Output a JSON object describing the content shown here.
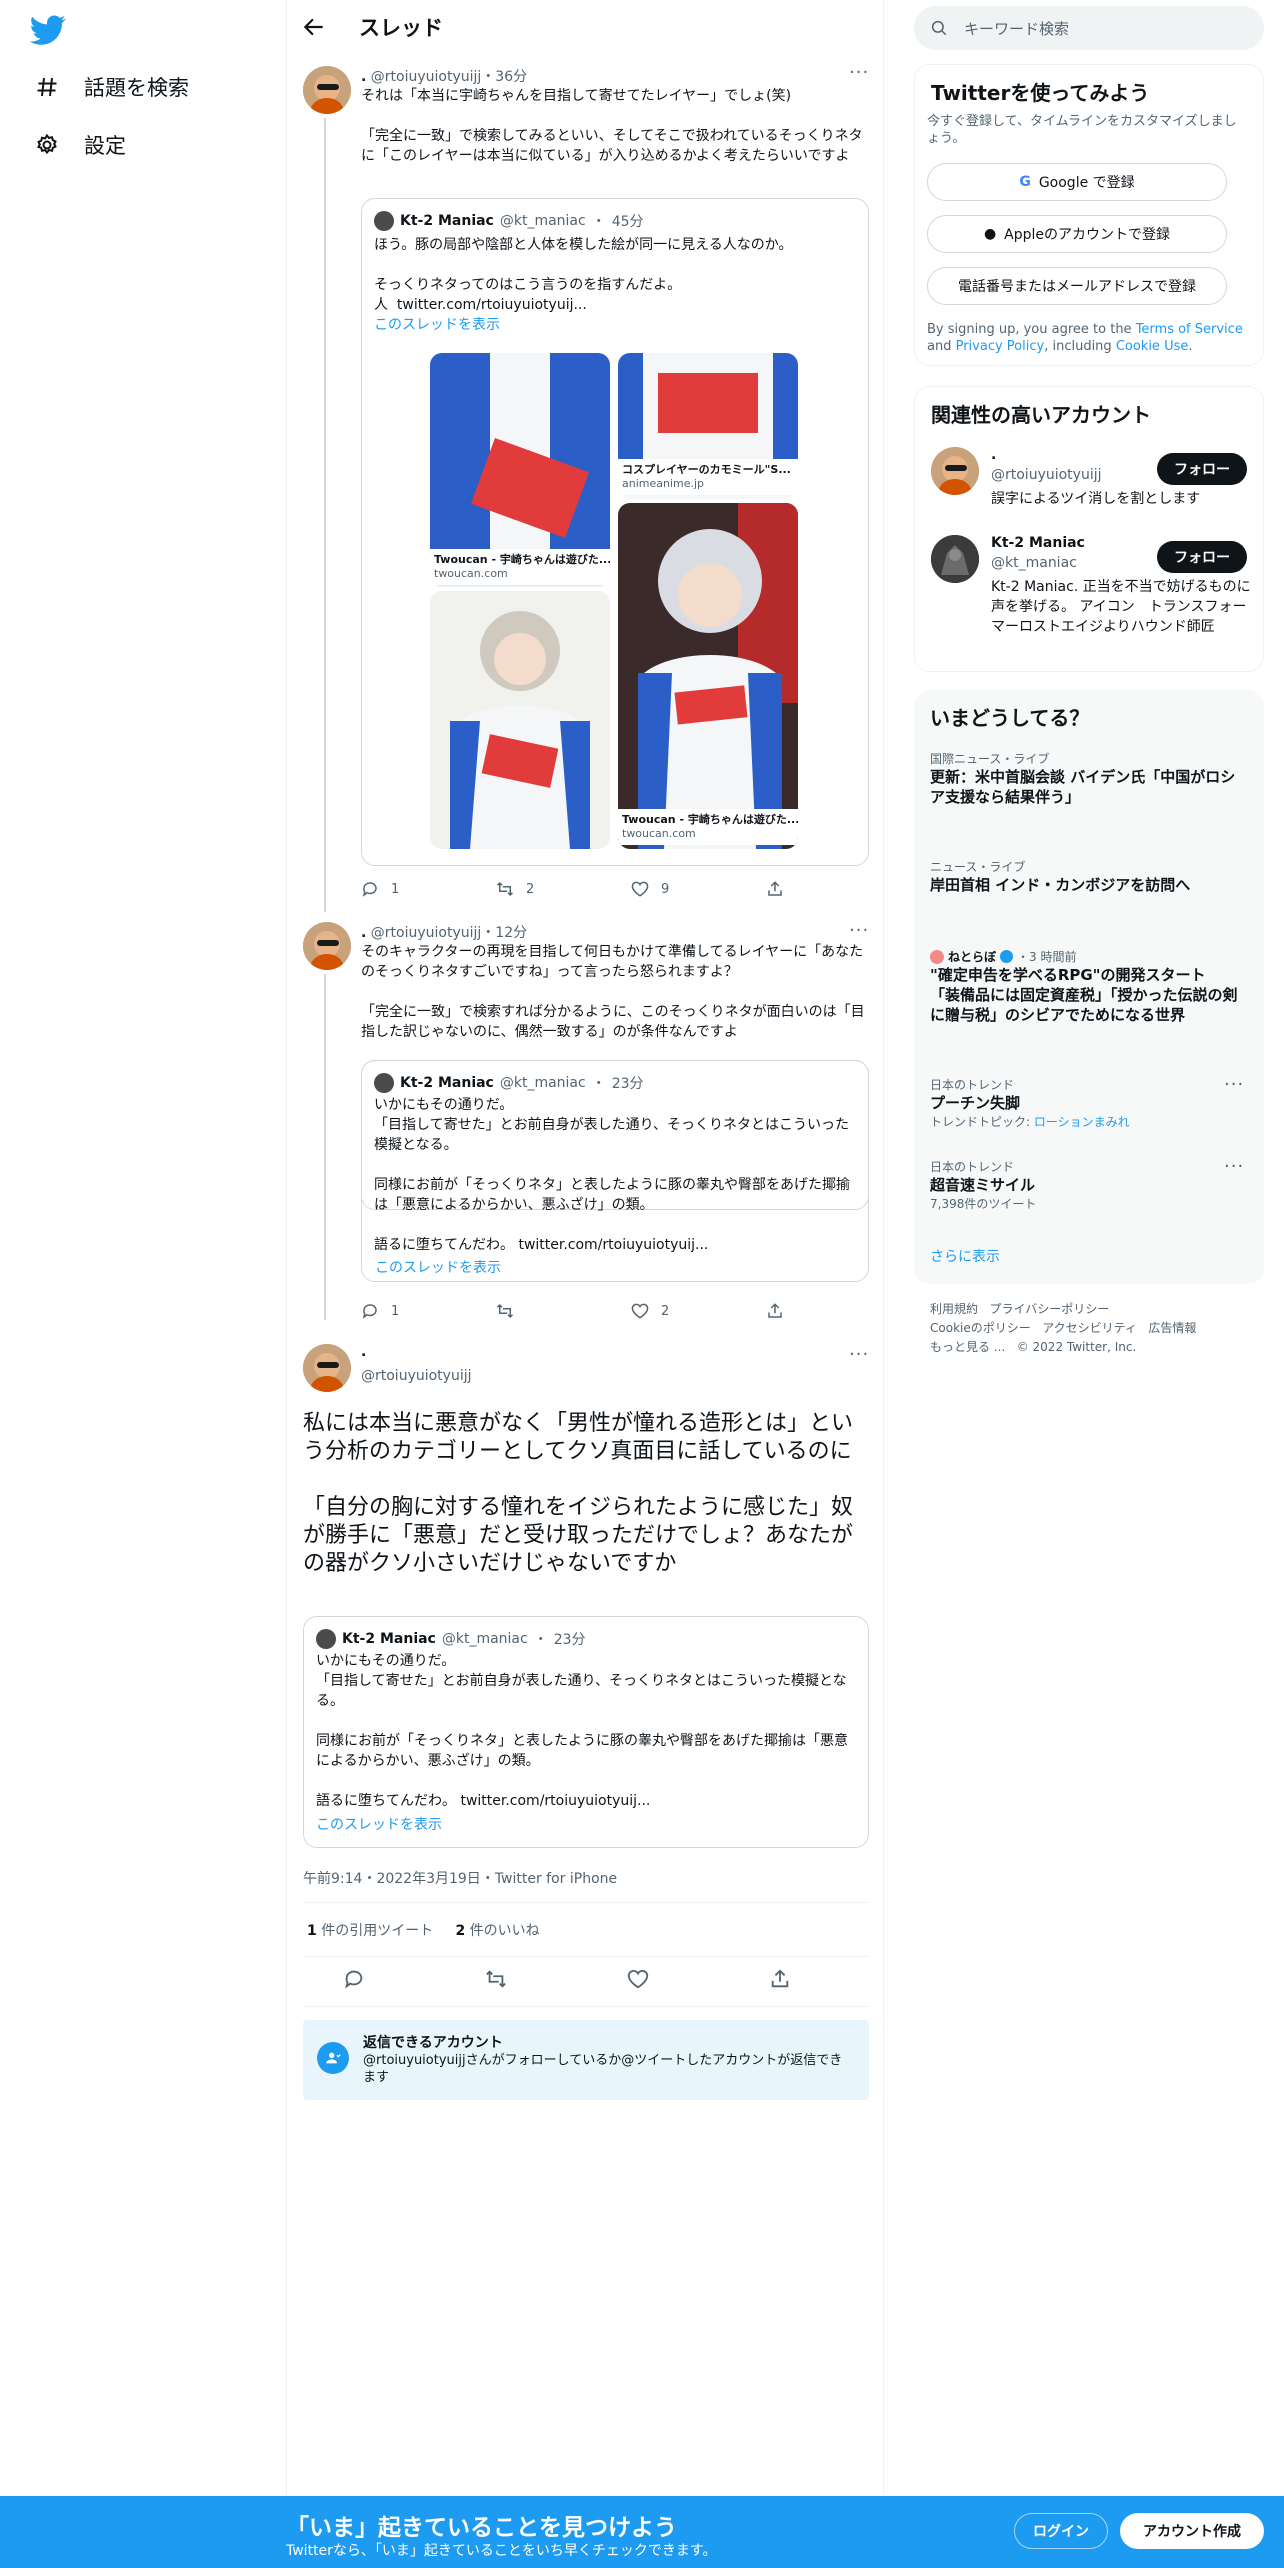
{
  "nav": {
    "explore_label": "話題を検索",
    "settings_label": "設定"
  },
  "header": {
    "title": "スレッド"
  },
  "tweet1": {
    "name": ".",
    "handle": "@rtoiuyuiotyuijj",
    "time": "36分",
    "text": "それは「本当に宇崎ちゃんを目指して寄せてたレイヤー」でしょ(笑)\n\n「完全に一致」で検索してみるといい、そしてそこで扱われているそっくりネタに「このレイヤーは本当に似ている」が入り込めるかよく考えたらいいですよ",
    "quote": {
      "name": "Kt-2 Maniac",
      "handle": "@kt_maniac",
      "time": "45分",
      "text": "ほう。豚の局部や陰部と人体を模した絵が同一に見える人なのか。\n\nそっくりネタってのはこう言うのを指すんだよ。\n人  twitter.com/rtoiuyuiotyuij...",
      "thread_link": "このスレッドを表示",
      "media": [
        {
          "title": "Twoucan - 宇崎ちゃんは遊びた...",
          "domain": "twoucan.com"
        },
        {
          "title": "コスプレイヤーのカモミール\"S...",
          "domain": "animeanime.jp"
        },
        {
          "title": "Twoucan - 宇崎ちゃんは遊びた...",
          "domain": "twoucan.com"
        }
      ]
    },
    "replies": "1",
    "retweets": "2",
    "likes": "9"
  },
  "tweet2": {
    "name": ".",
    "handle": "@rtoiuyuiotyuijj",
    "time": "12分",
    "text": "そのキャラクターの再現を目指して何日もかけて準備してるレイヤーに「あなたのそっくりネタすごいですね」って言ったら怒られますよ？\n\n「完全に一致」で検索すれば分かるように、このそっくりネタが面白いのは「目指した訳じゃないのに、偶然一致する」のが条件なんですよ",
    "quote": {
      "name": "Kt-2 Maniac",
      "handle": "@kt_maniac",
      "time": "23分",
      "text": "いかにもその通りだ。\n「目指して寄せた」とお前自身が表した通り、そっくりネタとはこういった模擬となる。\n\n同様にお前が「そっくりネタ」と表したように豚の睾丸や臀部をあげた揶揄は「悪意によるからかい、悪ふざけ」の類。\n\n語るに堕ちてんだわ。 twitter.com/rtoiuyuiotyuij...",
      "thread_link": "このスレッドを表示"
    },
    "replies": "1",
    "retweets": "",
    "likes": "2"
  },
  "main_tweet": {
    "name": ".",
    "handle": "@rtoiuyuiotyuijj",
    "text": "私には本当に悪意がなく「男性が憧れる造形とは」という分析のカテゴリーとしてクソ真面目に話しているのに\n\n「自分の胸に対する憧れをイジられたように感じた」奴が勝手に「悪意」だと受け取っただけでしょ？あなたがの器がクソ小さいだけじゃないですか",
    "quote": {
      "name": "Kt-2 Maniac",
      "handle": "@kt_maniac",
      "time": "23分",
      "text": "いかにもその通りだ。\n「目指して寄せた」とお前自身が表した通り、そっくりネタとはこういった模擬となる。\n\n同様にお前が「そっくりネタ」と表したように豚の睾丸や臀部をあげた揶揄は「悪意によるからかい、悪ふざけ」の類。\n\n語るに堕ちてんだわ。 twitter.com/rtoiuyuiotyuij...",
      "thread_link": "このスレッドを表示"
    },
    "timestamp": "午前9:14・2022年3月19日・Twitter for iPhone",
    "quote_count": "1",
    "quote_label": "件の引用ツイート",
    "like_count": "2",
    "like_label": "件のいいね",
    "reply_notice_title": "返信できるアカウント",
    "reply_notice_text": "@rtoiuyuiotyuijjさんがフォローしているか@ツイートしたアカウントが返信できます"
  },
  "search": {
    "placeholder": "キーワード検索"
  },
  "signup": {
    "title": "Twitterを使ってみよう",
    "subtitle": "今すぐ登録して、タイムラインをカスタマイズしましょう。",
    "google": "Google で登録",
    "apple": "Appleのアカウントで登録",
    "phone": "電話番号またはメールアドレスで登録",
    "terms_1": "By signing up, you agree to the ",
    "terms_link1": "Terms of Service",
    "terms_2": " and ",
    "terms_link2": "Privacy Policy",
    "terms_3": ", including ",
    "terms_link3": "Cookie Use",
    "terms_4": "."
  },
  "related": {
    "title": "関連性の高いアカウント",
    "accounts": [
      {
        "name": ".",
        "handle": "@rtoiuyuiotyuijj",
        "bio": "誤字によるツイ消しを割とします",
        "follow": "フォロー"
      },
      {
        "name": "Kt-2 Maniac",
        "handle": "@kt_maniac",
        "bio": "Kt-2 Maniac. 正当を不当で妨げるものに声を挙げる。 アイコン　トランスフォーマーロストエイジよりハウンド師匠",
        "follow": "フォロー"
      }
    ]
  },
  "trends": {
    "title": "いまどうしてる？",
    "items": [
      {
        "category": "国際ニュース・ライブ",
        "title": "更新：米中首脳会談 バイデン氏「中国がロシア支援なら結果伴う」"
      },
      {
        "category": "ニュース・ライブ",
        "title": "岸田首相 インド・カンボジアを訪問へ"
      },
      {
        "category": "ねとらぼ",
        "badge": "・3 時間前",
        "title": "\"確定申告を学べるRPG\"の開発スタート　「装備品には固定資産税」「授かった伝説の剣に贈与税」のシビアでためになる世界"
      },
      {
        "category": "日本のトレンド",
        "title": "プーチン失脚",
        "sub_label": "トレンドトピック: ",
        "sub_link": "ローションまみれ"
      },
      {
        "category": "日本のトレンド",
        "title": "超音速ミサイル",
        "sub_label": "7,398件のツイート"
      }
    ],
    "show_more": "さらに表示"
  },
  "footer": {
    "links": [
      "利用規約",
      "プライバシーポリシー",
      "Cookieのポリシー",
      "アクセシビリティ",
      "広告情報",
      "もっと見る ..."
    ],
    "copyright": "© 2022 Twitter, Inc."
  },
  "bottom": {
    "title": "「いま」起きていることを見つけよう",
    "subtitle": "Twitterなら、「いま」起きていることをいち早くチェックできます。",
    "login": "ログイン",
    "signup": "アカウント作成"
  },
  "colors": {
    "brand": "#1d9bf0",
    "text": "#0f1419",
    "muted": "#536471"
  }
}
